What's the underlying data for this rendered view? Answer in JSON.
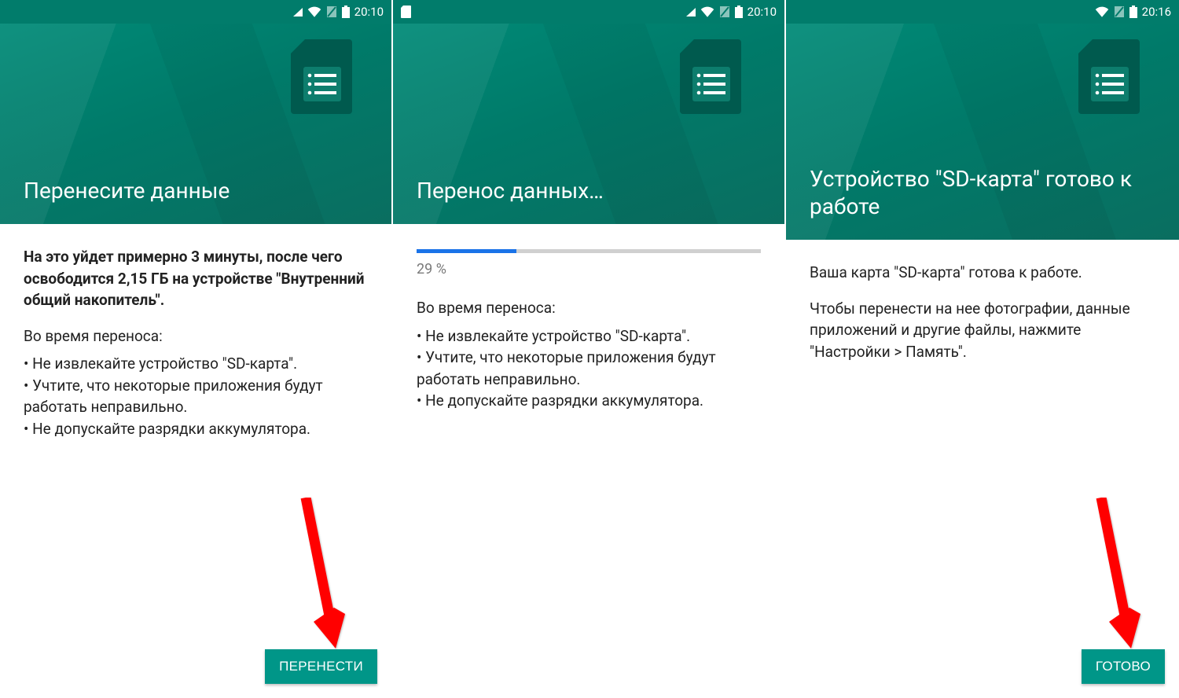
{
  "colors": {
    "accent": "#009688",
    "headerDark": "#017c6b",
    "progress": "#1a73e8"
  },
  "screens": {
    "left": {
      "status": {
        "time": "20:10"
      },
      "title": "Перенесите данные",
      "bold_summary": "На это уйдет примерно 3 минуты, после чего освободится 2,15 ГБ на устройстве \"Внутренний общий накопитель\".",
      "during_heading": "Во время переноса:",
      "bullets": [
        "• Не извлекайте устройство \"SD-карта\".",
        "• Учтите, что некоторые приложения будут работать неправильно.",
        "• Не допускайте разрядки аккумулятора."
      ],
      "button": "ПЕРЕНЕСТИ"
    },
    "middle": {
      "status": {
        "time": "20:10"
      },
      "title": "Перенос данных…",
      "progress_percent": 29,
      "progress_label": "29 %",
      "during_heading": "Во время переноса:",
      "bullets": [
        "• Не извлекайте устройство \"SD-карта\".",
        "• Учтите, что некоторые приложения будут работать неправильно.",
        "• Не допускайте разрядки аккумулятора."
      ]
    },
    "right": {
      "status": {
        "time": "20:16"
      },
      "title": "Устройство \"SD-карта\" готово к работе",
      "body1": "Ваша карта \"SD-карта\" готова к работе.",
      "body2": "Чтобы перенести на нее фотографии, данные приложений и другие файлы, нажмите \"Настройки > Память\".",
      "button": "ГОТОВО"
    }
  }
}
